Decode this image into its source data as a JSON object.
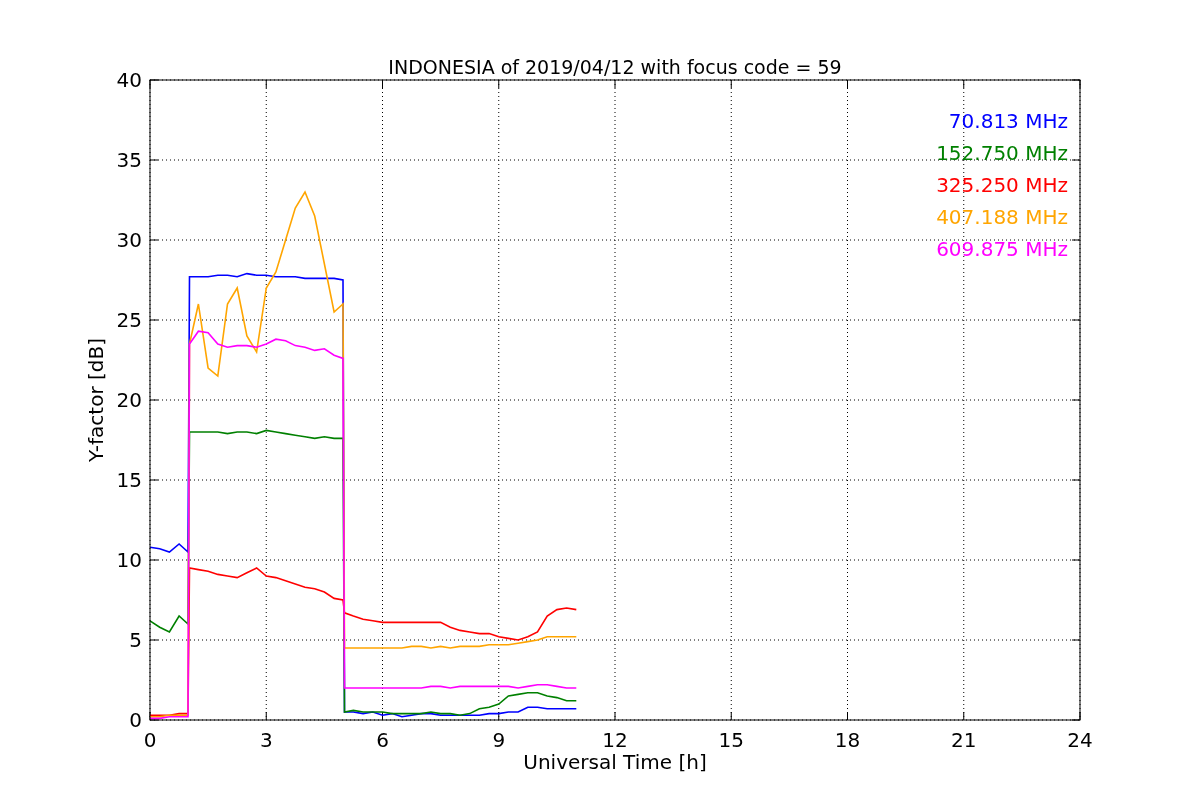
{
  "figure": {
    "chart_data": {
      "type": "line",
      "title": "INDONESIA of 2019/04/12 with focus code = 59",
      "xlabel": "Universal Time [h]",
      "ylabel": "Y-factor [dB]",
      "x": [
        0,
        0.25,
        0.5,
        0.75,
        0.98,
        1.02,
        1.25,
        1.5,
        1.75,
        2,
        2.25,
        2.5,
        2.75,
        3,
        3.25,
        3.5,
        3.75,
        4,
        4.25,
        4.5,
        4.75,
        4.98,
        5.02,
        5.25,
        5.5,
        5.75,
        6,
        6.25,
        6.5,
        6.75,
        7,
        7.25,
        7.5,
        7.75,
        8,
        8.25,
        8.5,
        8.75,
        9,
        9.25,
        9.5,
        9.75,
        10,
        10.25,
        10.5,
        10.75,
        11
      ],
      "series": [
        {
          "name": "70.813 MHz",
          "color": "#0000ff",
          "values": [
            10.8,
            10.7,
            10.5,
            11,
            10.5,
            27.7,
            27.7,
            27.7,
            27.8,
            27.8,
            27.7,
            27.9,
            27.8,
            27.8,
            27.7,
            27.7,
            27.7,
            27.6,
            27.6,
            27.6,
            27.6,
            27.5,
            0.5,
            0.5,
            0.4,
            0.5,
            0.3,
            0.4,
            0.2,
            0.3,
            0.4,
            0.4,
            0.3,
            0.3,
            0.3,
            0.3,
            0.3,
            0.4,
            0.4,
            0.5,
            0.5,
            0.8,
            0.8,
            0.7,
            0.7,
            0.7,
            0.7
          ]
        },
        {
          "name": "152.750 MHz",
          "color": "#008000",
          "values": [
            6.2,
            5.8,
            5.5,
            6.5,
            6,
            18,
            18,
            18,
            18,
            17.9,
            18,
            18,
            17.9,
            18.1,
            18,
            17.9,
            17.8,
            17.7,
            17.6,
            17.7,
            17.6,
            17.6,
            0.5,
            0.6,
            0.5,
            0.5,
            0.5,
            0.4,
            0.4,
            0.4,
            0.4,
            0.5,
            0.4,
            0.4,
            0.3,
            0.4,
            0.7,
            0.8,
            1,
            1.5,
            1.6,
            1.7,
            1.7,
            1.5,
            1.4,
            1.2,
            1.2
          ]
        },
        {
          "name": "325.250 MHz",
          "color": "#ff0000",
          "values": [
            0.3,
            0.3,
            0.3,
            0.4,
            0.4,
            9.5,
            9.4,
            9.3,
            9.1,
            9,
            8.9,
            9.2,
            9.5,
            9,
            8.9,
            8.7,
            8.5,
            8.3,
            8.2,
            8,
            7.6,
            7.5,
            6.7,
            6.5,
            6.3,
            6.2,
            6.1,
            6.1,
            6.1,
            6.1,
            6.1,
            6.1,
            6.1,
            5.8,
            5.6,
            5.5,
            5.4,
            5.4,
            5.2,
            5.1,
            5,
            5.2,
            5.5,
            6.5,
            6.9,
            7,
            6.9
          ]
        },
        {
          "name": "407.188 MHz",
          "color": "#ffa500",
          "values": [
            0.2,
            0.2,
            0.3,
            0.3,
            0.3,
            23.5,
            26,
            22,
            21.5,
            26,
            27,
            24,
            23,
            27,
            28,
            30,
            32,
            33,
            31.5,
            28.5,
            25.5,
            26,
            4.5,
            4.5,
            4.5,
            4.5,
            4.5,
            4.5,
            4.5,
            4.6,
            4.6,
            4.5,
            4.6,
            4.5,
            4.6,
            4.6,
            4.6,
            4.7,
            4.7,
            4.7,
            4.8,
            4.9,
            5,
            5.2,
            5.2,
            5.2,
            5.2
          ]
        },
        {
          "name": "609.875 MHz",
          "color": "#ff00ff",
          "values": [
            0.1,
            0.1,
            0.2,
            0.2,
            0.2,
            23.5,
            24.3,
            24.2,
            23.5,
            23.3,
            23.4,
            23.4,
            23.3,
            23.5,
            23.8,
            23.7,
            23.4,
            23.3,
            23.1,
            23.2,
            22.8,
            22.6,
            2,
            2,
            2,
            2,
            2,
            2,
            2,
            2,
            2,
            2.1,
            2.1,
            2,
            2.1,
            2.1,
            2.1,
            2.1,
            2.1,
            2.1,
            2,
            2.1,
            2.2,
            2.2,
            2.1,
            2,
            2
          ]
        }
      ],
      "grid": true,
      "xlim": [
        0,
        24
      ],
      "ylim": [
        0,
        40
      ],
      "xticks": [
        0,
        3,
        6,
        9,
        12,
        15,
        18,
        21,
        24
      ],
      "yticks": [
        0,
        5,
        10,
        15,
        20,
        25,
        30,
        35,
        40
      ]
    }
  }
}
